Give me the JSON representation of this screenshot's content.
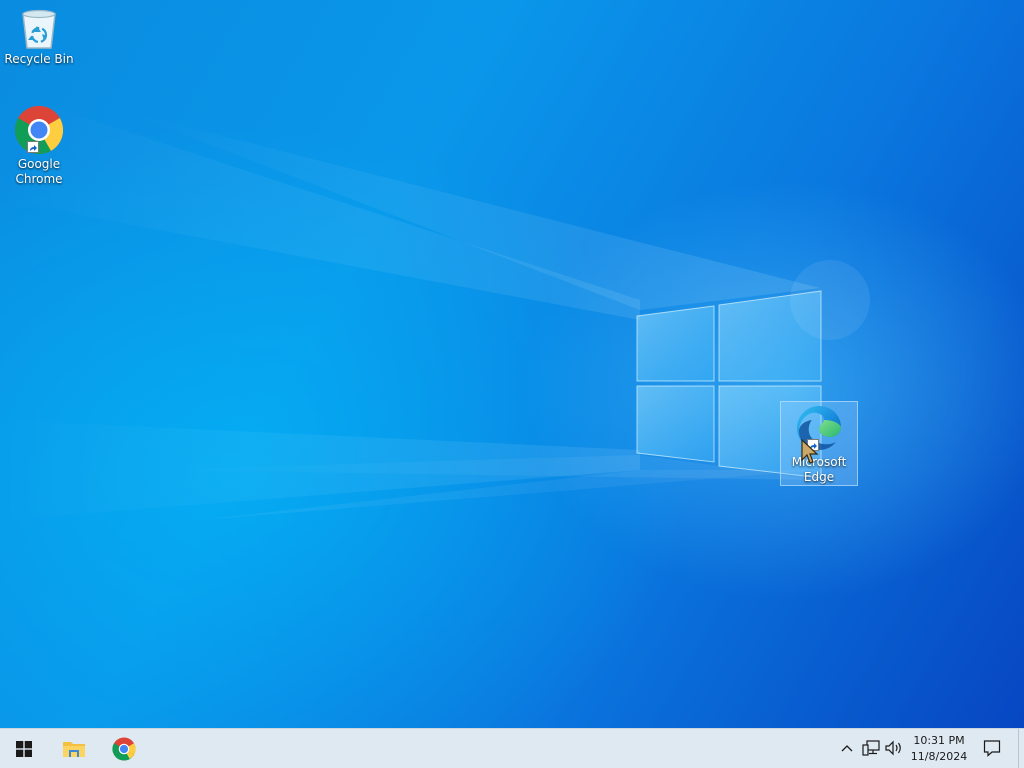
{
  "desktop": {
    "icons": [
      {
        "id": "recycle-bin",
        "label": "Recycle Bin",
        "icon": "recycle-bin-icon"
      },
      {
        "id": "google-chrome",
        "label": "Google\nChrome",
        "label_line1": "Google",
        "label_line2": "Chrome",
        "icon": "chrome-icon",
        "shortcut": true
      },
      {
        "id": "microsoft-edge",
        "label_line1": "Microsoft",
        "label_line2": "Edge",
        "icon": "edge-icon",
        "shortcut": true,
        "selected": true
      }
    ]
  },
  "taskbar": {
    "pinned": [
      {
        "name": "start",
        "icon": "windows-logo-icon"
      },
      {
        "name": "file-explorer",
        "icon": "folder-icon"
      },
      {
        "name": "google-chrome",
        "icon": "chrome-icon"
      }
    ],
    "tray": {
      "icons": [
        "chevron-up-icon",
        "network-icon",
        "volume-icon"
      ],
      "time": "10:31 PM",
      "date": "11/8/2024",
      "notification_icon": "action-center-icon"
    }
  },
  "colors": {
    "wallpaper_primary": "#0a8ce0",
    "wallpaper_dark": "#0746c2",
    "taskbar": "#dfe9f2",
    "selection": "#add6ff"
  }
}
